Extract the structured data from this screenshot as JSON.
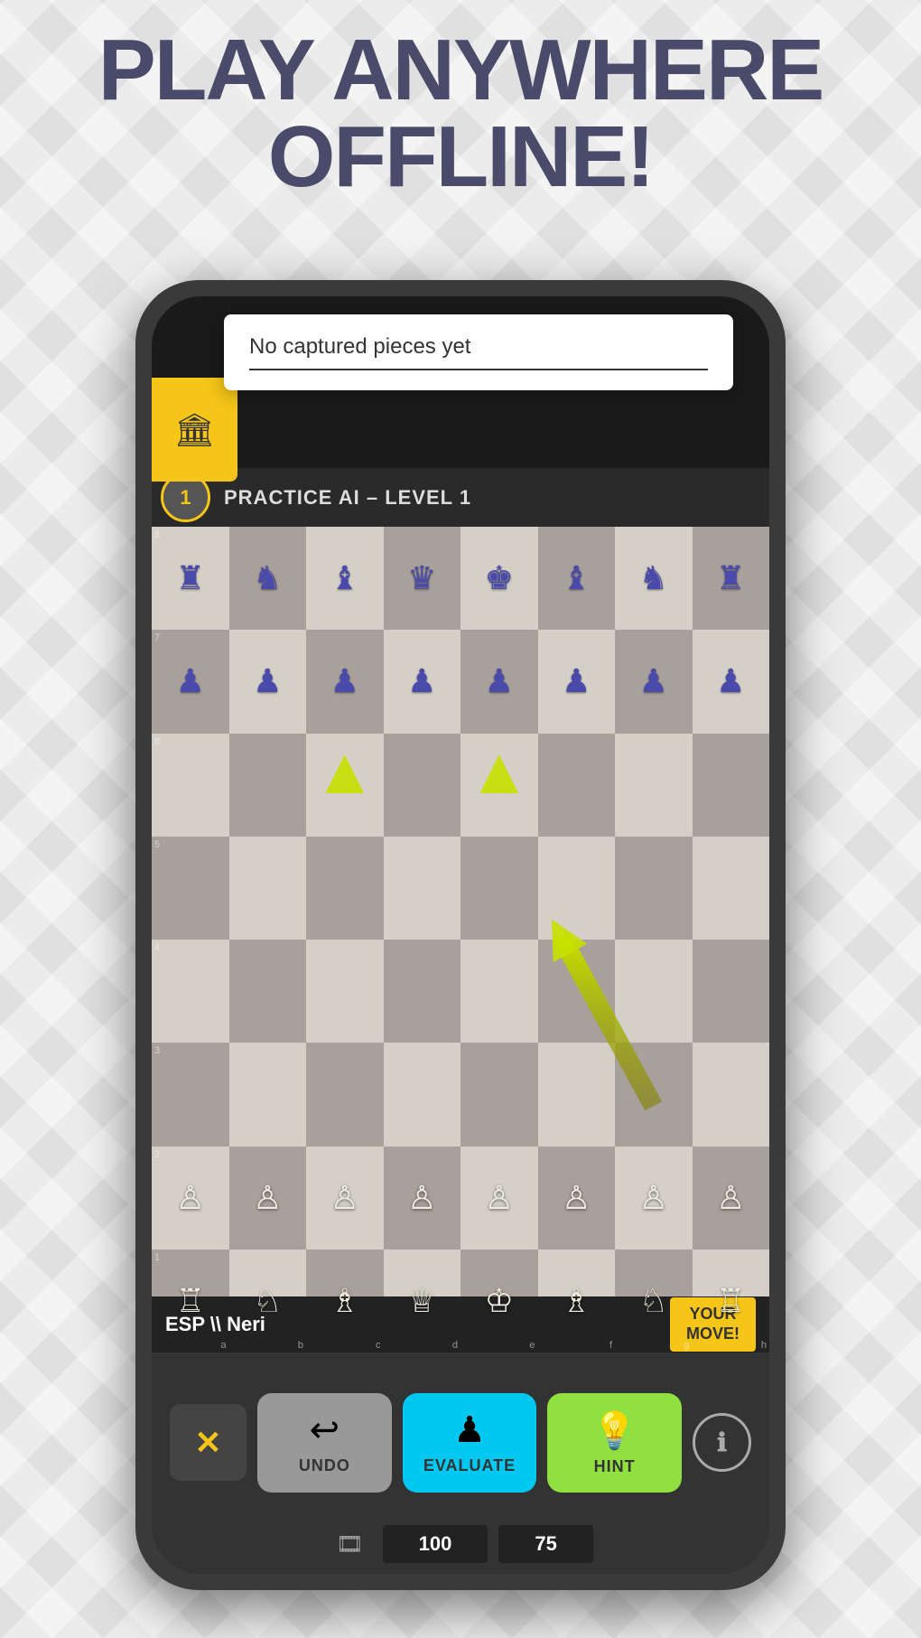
{
  "hero": {
    "line1": "PLAY ANYWHERE",
    "line2": "OFFLINE!"
  },
  "tooltip": {
    "text": "No captured pieces yet",
    "line": true
  },
  "header": {
    "level": "1",
    "practice_label": "PRACTICE AI – LEVEL 1"
  },
  "board": {
    "rows": 8,
    "cols": 8,
    "row_labels": [
      "8",
      "7",
      "6",
      "5",
      "4",
      "3",
      "2",
      "1"
    ],
    "col_labels": [
      "a",
      "b",
      "c",
      "d",
      "e",
      "f",
      "g",
      "h"
    ],
    "pieces": [
      {
        "row": 0,
        "col": 0,
        "type": "♜",
        "side": "black"
      },
      {
        "row": 0,
        "col": 1,
        "type": "♞",
        "side": "black"
      },
      {
        "row": 0,
        "col": 2,
        "type": "♝",
        "side": "black"
      },
      {
        "row": 0,
        "col": 3,
        "type": "♛",
        "side": "black"
      },
      {
        "row": 0,
        "col": 4,
        "type": "♚",
        "side": "black"
      },
      {
        "row": 0,
        "col": 5,
        "type": "♝",
        "side": "black"
      },
      {
        "row": 0,
        "col": 6,
        "type": "♞",
        "side": "black"
      },
      {
        "row": 0,
        "col": 7,
        "type": "♜",
        "side": "black"
      },
      {
        "row": 1,
        "col": 0,
        "type": "♟",
        "side": "black"
      },
      {
        "row": 1,
        "col": 1,
        "type": "♟",
        "side": "black"
      },
      {
        "row": 1,
        "col": 2,
        "type": "♟",
        "side": "black"
      },
      {
        "row": 1,
        "col": 3,
        "type": "♟",
        "side": "black"
      },
      {
        "row": 1,
        "col": 4,
        "type": "♟",
        "side": "black"
      },
      {
        "row": 1,
        "col": 5,
        "type": "♟",
        "side": "black"
      },
      {
        "row": 1,
        "col": 6,
        "type": "♟",
        "side": "black"
      },
      {
        "row": 1,
        "col": 7,
        "type": "♟",
        "side": "black"
      },
      {
        "row": 6,
        "col": 0,
        "type": "♙",
        "side": "white"
      },
      {
        "row": 6,
        "col": 1,
        "type": "♙",
        "side": "white"
      },
      {
        "row": 6,
        "col": 2,
        "type": "♙",
        "side": "white"
      },
      {
        "row": 6,
        "col": 3,
        "type": "♙",
        "side": "white"
      },
      {
        "row": 6,
        "col": 4,
        "type": "♙",
        "side": "white"
      },
      {
        "row": 6,
        "col": 5,
        "type": "♙",
        "side": "white"
      },
      {
        "row": 6,
        "col": 6,
        "type": "♙",
        "side": "white"
      },
      {
        "row": 6,
        "col": 7,
        "type": "♙",
        "side": "white"
      },
      {
        "row": 7,
        "col": 0,
        "type": "♖",
        "side": "white"
      },
      {
        "row": 7,
        "col": 1,
        "type": "♘",
        "side": "white"
      },
      {
        "row": 7,
        "col": 2,
        "type": "♗",
        "side": "white"
      },
      {
        "row": 7,
        "col": 3,
        "type": "♕",
        "side": "white"
      },
      {
        "row": 7,
        "col": 4,
        "type": "♔",
        "side": "white"
      },
      {
        "row": 7,
        "col": 5,
        "type": "♗",
        "side": "white"
      },
      {
        "row": 7,
        "col": 6,
        "type": "♘",
        "side": "white"
      },
      {
        "row": 7,
        "col": 7,
        "type": "♖",
        "side": "white"
      }
    ],
    "arrows": [
      {
        "from_col": 2,
        "from_row": 6,
        "to_col": 2,
        "to_row": 3
      },
      {
        "from_col": 4,
        "from_row": 6,
        "to_col": 4,
        "to_row": 3
      },
      {
        "from_col": 6,
        "from_row": 7,
        "to_col": 5,
        "to_row": 5
      }
    ]
  },
  "player": {
    "name": "ESP \\\\ Neri",
    "your_move": "YOUR\nMOVE!"
  },
  "controls": {
    "undo_label": "UNDO",
    "evaluate_label": "EVALUATE",
    "hint_label": "HINT",
    "score1": "100",
    "score2": "75"
  },
  "colors": {
    "accent_yellow": "#f5c518",
    "btn_evaluate": "#00c8f0",
    "btn_hint": "#90e040",
    "piece_black": "#5555bb",
    "piece_white": "#f0ede0"
  }
}
